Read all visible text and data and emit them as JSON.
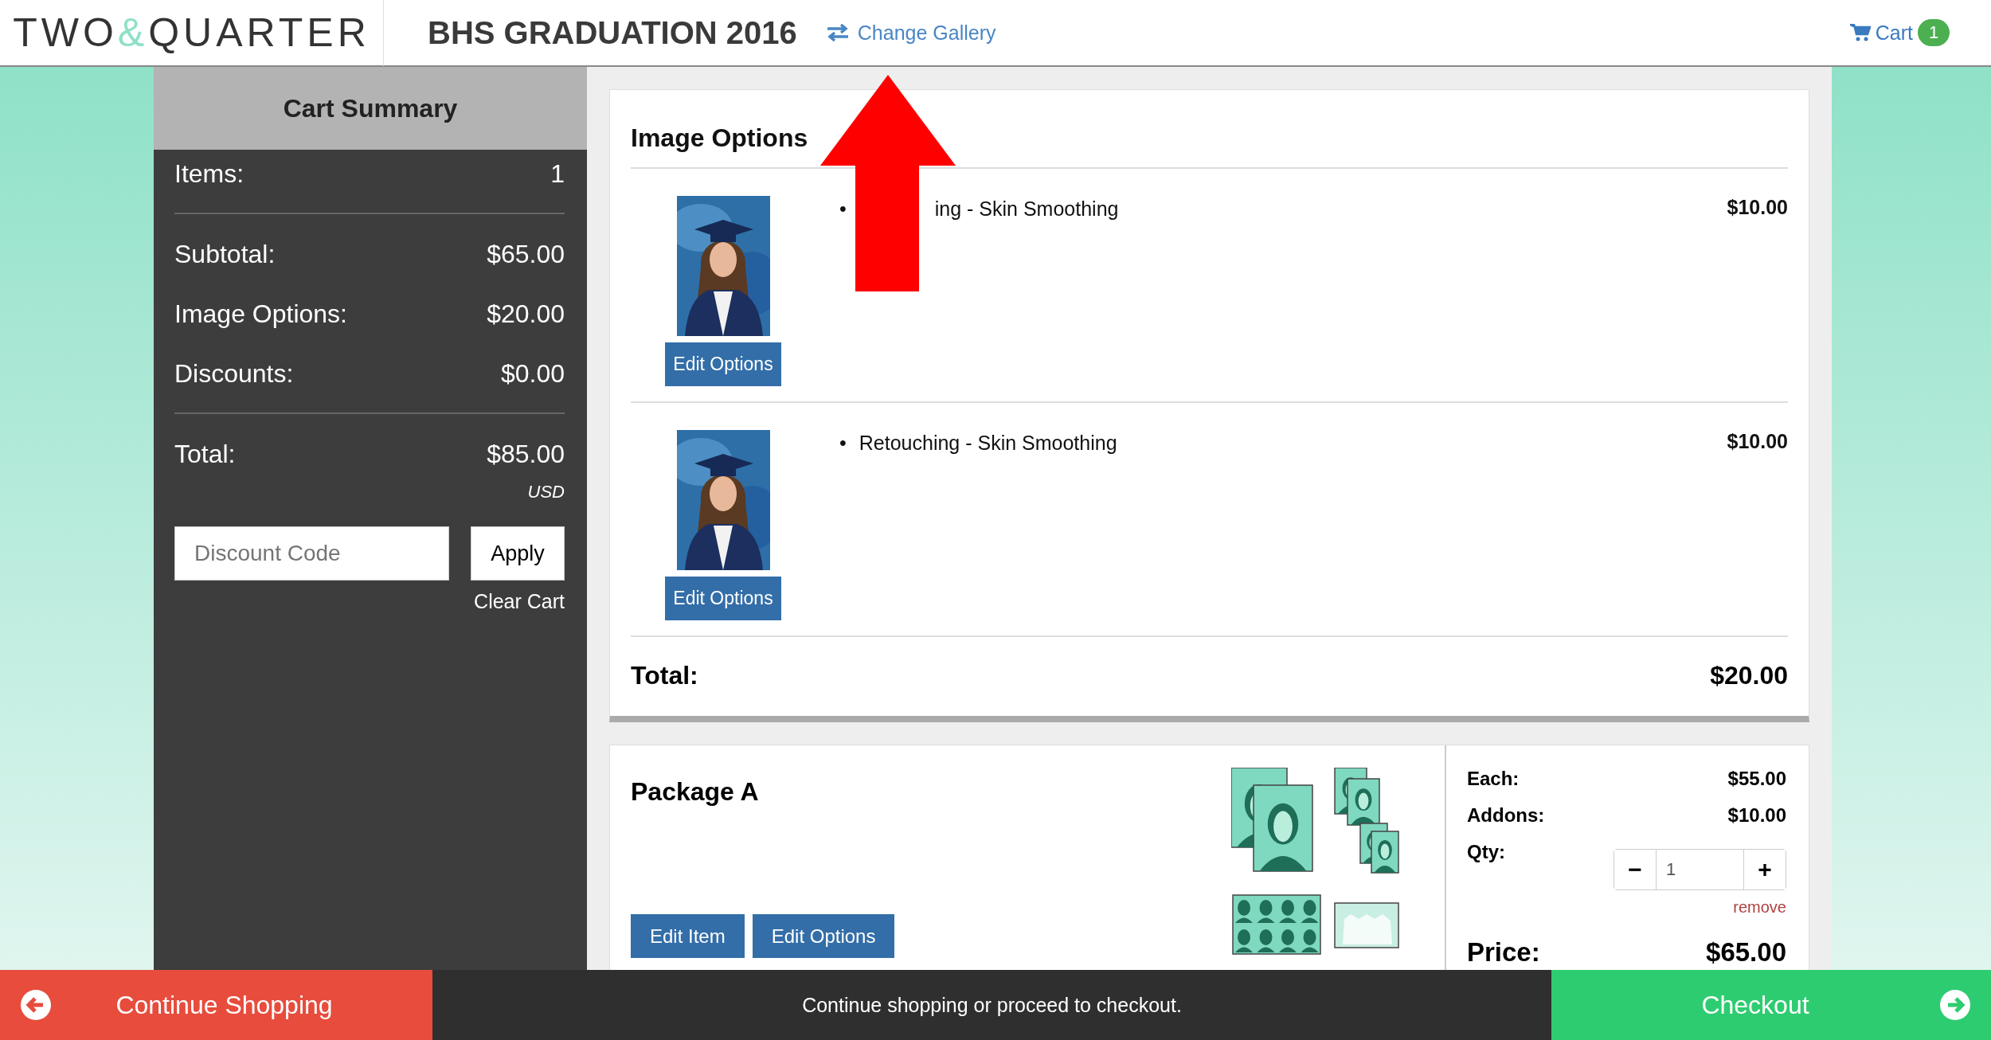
{
  "header": {
    "logo_left": "TWO",
    "logo_amp": "&",
    "logo_right": "QUARTER",
    "gallery_title": "BHS GRADUATION 2016",
    "change_gallery": "Change Gallery",
    "cart_label": "Cart",
    "cart_count": "1"
  },
  "cart_summary": {
    "title": "Cart Summary",
    "items_label": "Items:",
    "items_value": "1",
    "lines": [
      {
        "label": "Subtotal:",
        "value": "$65.00"
      },
      {
        "label": "Image Options:",
        "value": "$20.00"
      },
      {
        "label": "Discounts:",
        "value": "$0.00"
      }
    ],
    "total_label": "Total:",
    "total_value": "$85.00",
    "currency": "USD",
    "discount_placeholder": "Discount Code",
    "apply": "Apply",
    "clear_cart": "Clear Cart"
  },
  "image_options": {
    "title": "Image Options",
    "rows": [
      {
        "bullet": "•",
        "option": "ing - Skin Smoothing",
        "kind": "annotated",
        "price": "$10.00",
        "button": "Edit Options"
      },
      {
        "bullet": "•",
        "option": "Retouching - Skin Smoothing",
        "kind": "plain",
        "price": "$10.00",
        "button": "Edit Options"
      }
    ],
    "total_label": "Total:",
    "total_value": "$20.00"
  },
  "package": {
    "title": "Package A",
    "buttons": [
      "Edit Item",
      "Edit Options"
    ],
    "each_label": "Each:",
    "each_value": "$55.00",
    "addons_label": "Addons:",
    "addons_value": "$10.00",
    "qty_label": "Qty:",
    "qty_minus": "−",
    "qty": "1",
    "qty_plus": "+",
    "remove": "remove",
    "price_label": "Price:",
    "price_value": "$65.00"
  },
  "footer": {
    "continue": "Continue Shopping",
    "message": "Continue shopping or proceed to checkout.",
    "checkout": "Checkout"
  }
}
